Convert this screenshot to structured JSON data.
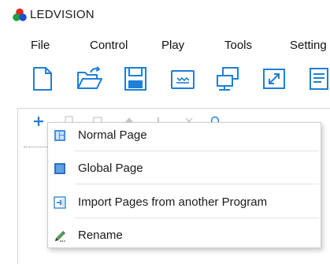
{
  "app": {
    "title": "LEDVISION"
  },
  "menubar": {
    "items": [
      {
        "label": "File"
      },
      {
        "label": "Control"
      },
      {
        "label": "Play"
      },
      {
        "label": "Tools"
      },
      {
        "label": "Setting"
      }
    ]
  },
  "toolbar": {
    "buttons": [
      {
        "icon": "new-file-icon"
      },
      {
        "icon": "open-folder-icon"
      },
      {
        "icon": "save-icon"
      },
      {
        "icon": "led-screen-icon"
      },
      {
        "icon": "network-computer-icon"
      },
      {
        "icon": "fullscreen-icon"
      },
      {
        "icon": "document-edit-icon"
      }
    ],
    "accent_color": "#1e7fd6"
  },
  "context_menu": {
    "items": [
      {
        "label": "Normal Page",
        "icon": "normal-page-icon"
      },
      {
        "label": "Global Page",
        "icon": "global-page-icon"
      },
      {
        "label": "Import Pages from another Program",
        "icon": "import-pages-icon"
      },
      {
        "label": "Rename",
        "icon": "rename-icon"
      }
    ]
  }
}
